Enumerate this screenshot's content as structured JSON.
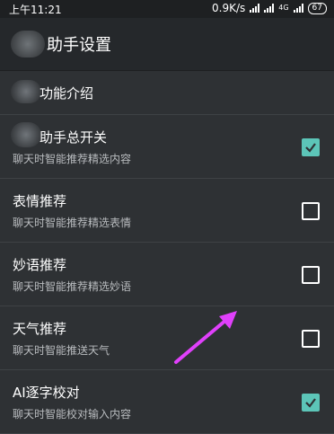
{
  "status_bar": {
    "time": "上午11:21",
    "net_speed": "0.9K/s",
    "net_type": "4G",
    "battery": "67"
  },
  "header": {
    "title": "助手设置"
  },
  "section": {
    "label": "功能介绍"
  },
  "settings": [
    {
      "title": "助手总开关",
      "desc": "聊天时智能推荐精选内容",
      "checked": true
    },
    {
      "title": "表情推荐",
      "desc": "聊天时智能推荐精选表情",
      "checked": false
    },
    {
      "title": "妙语推荐",
      "desc": "聊天时智能推荐精选妙语",
      "checked": false
    },
    {
      "title": "天气推荐",
      "desc": "聊天时智能推送天气",
      "checked": false
    },
    {
      "title": "AI逐字校对",
      "desc": "聊天时智能校对输入内容",
      "checked": true
    }
  ],
  "colors": {
    "accent": "#5cc5b8",
    "annotation_arrow": "#e040fb",
    "background": "#2e3134"
  }
}
